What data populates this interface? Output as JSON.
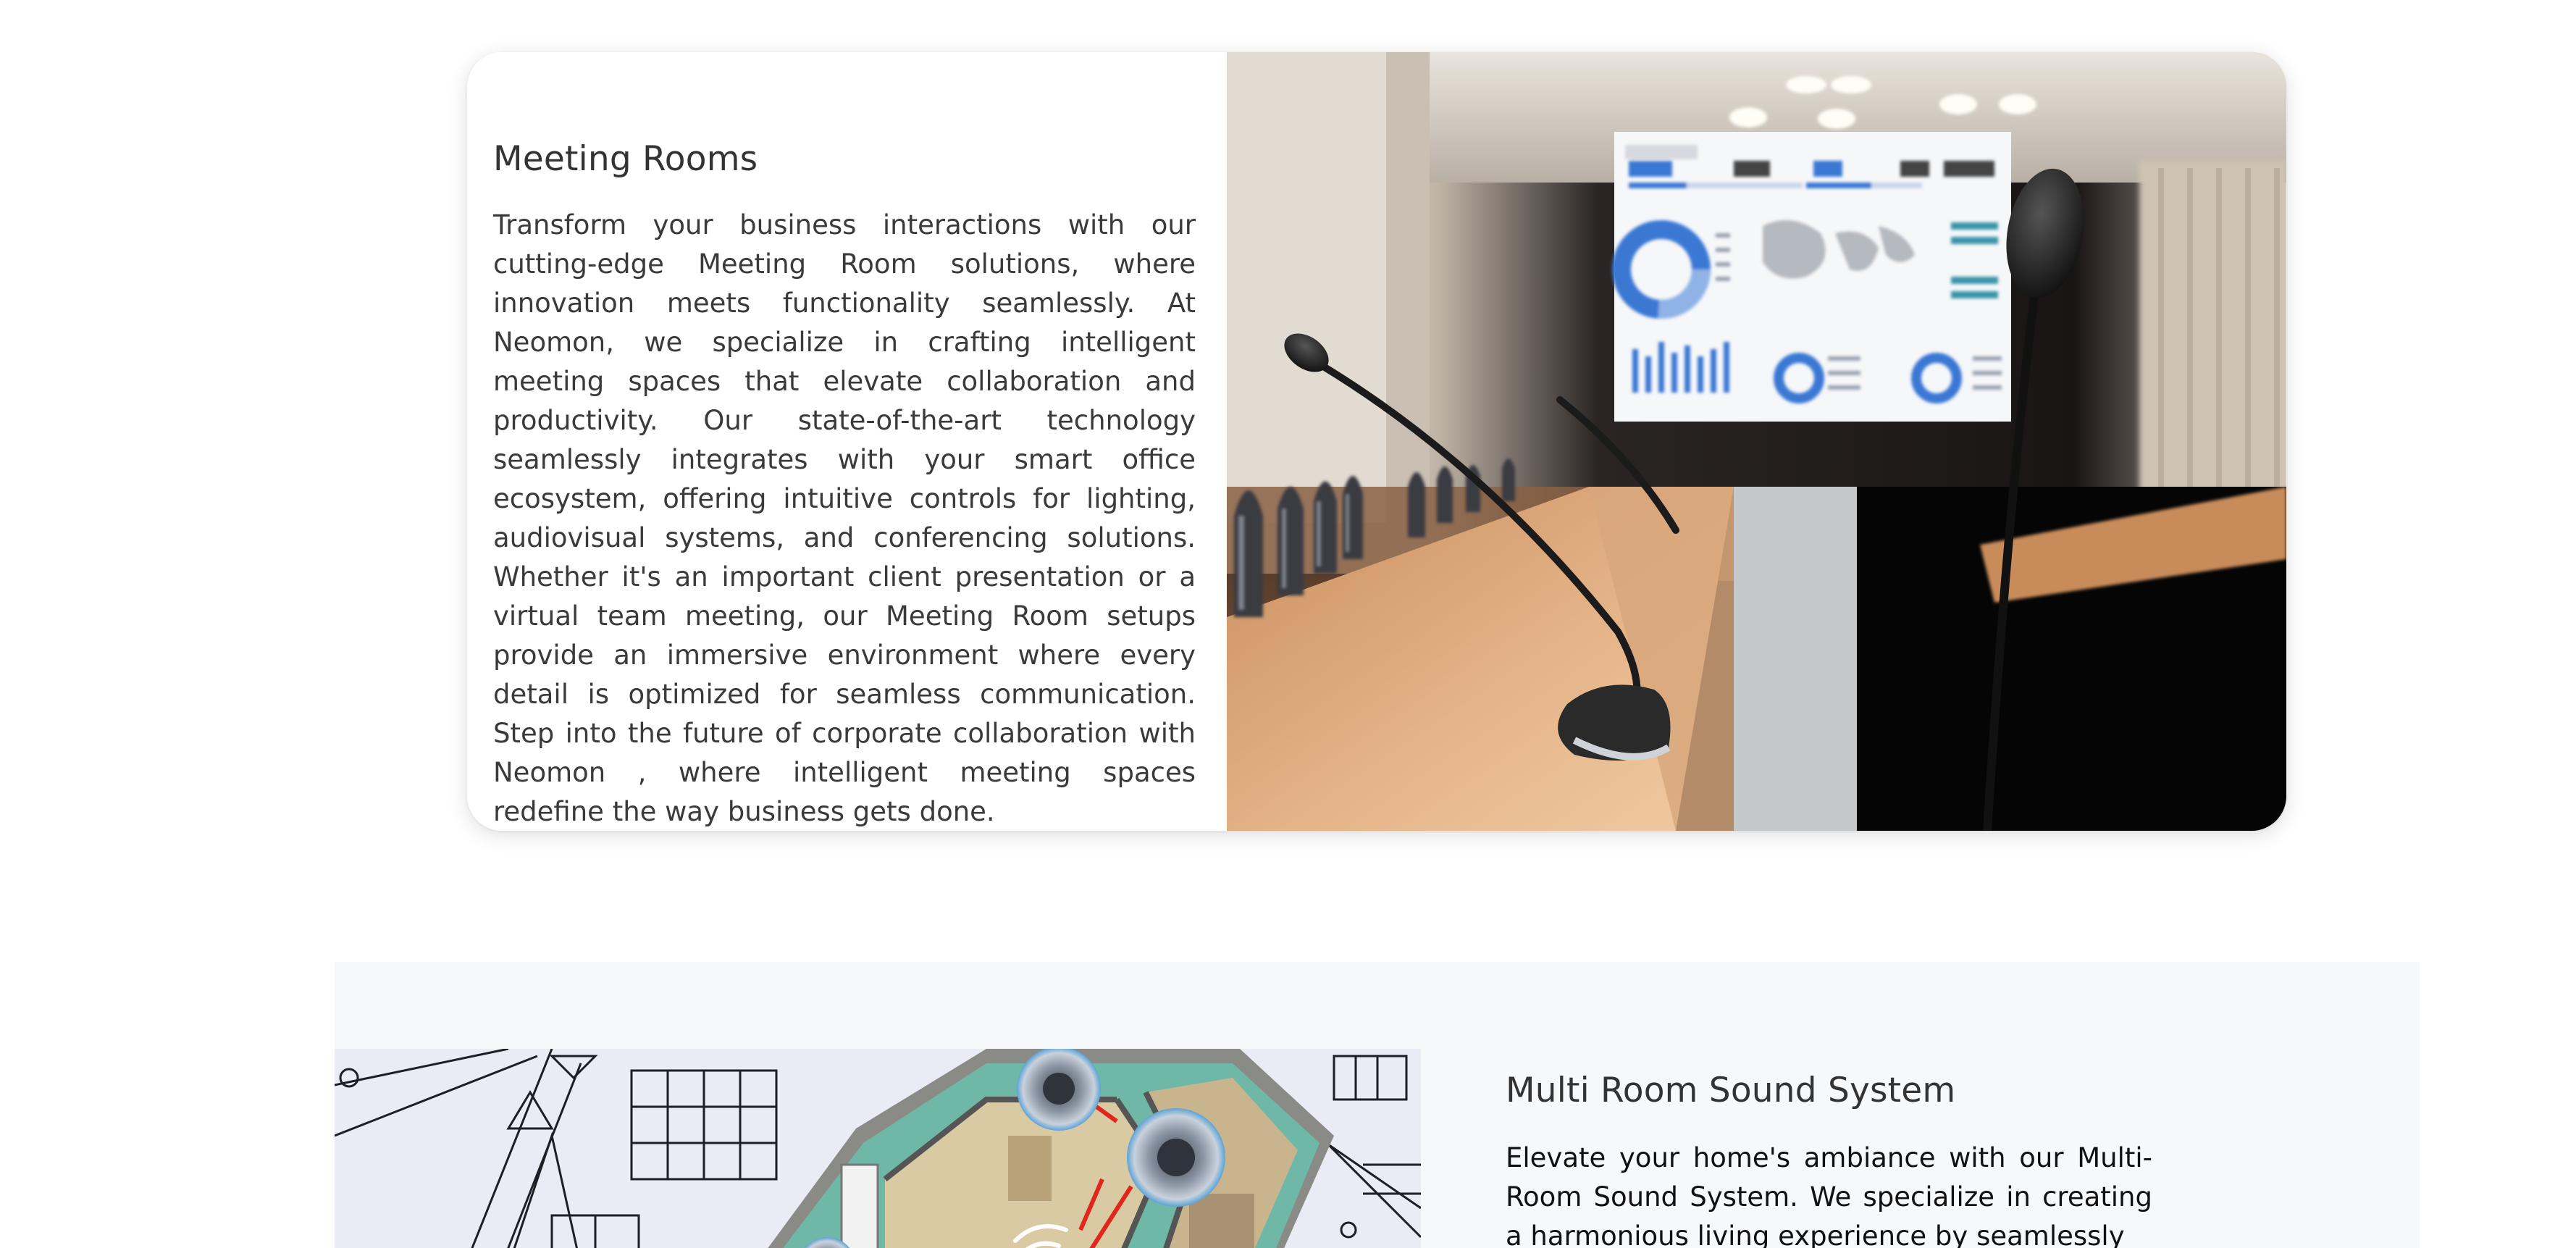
{
  "meeting_rooms": {
    "title": "Meeting Rooms",
    "body": "Transform your business interactions with our cutting-edge Meeting Room solutions, where innovation meets functionality seamlessly. At Neomon, we specialize in crafting intelligent meeting spaces that elevate collaboration and productivity. Our state-of-the-art technology seamlessly integrates with your smart office ecosystem, offering intuitive controls for lighting, audiovisual systems, and conferencing solutions. Whether it's an important client presentation or a virtual team meeting, our Meeting Room setups provide an immersive environment where every detail is optimized for seamless communication. Step into the future of corporate collaboration with Neomon , where intelligent meeting spaces redefine the way business gets done.",
    "image": "conference-room-photo"
  },
  "multi_room": {
    "title": "Multi Room Sound System",
    "body": "Elevate your home's ambiance with our Multi-Room Sound System. We specialize in creating a harmonious living experience by seamlessly",
    "image": "multi-room-floorplan-illustration"
  },
  "colors": {
    "heading": "#333333",
    "body_text": "#3a3a3a",
    "section_bg": "#f7f8fa",
    "card_bg": "#ffffff"
  }
}
